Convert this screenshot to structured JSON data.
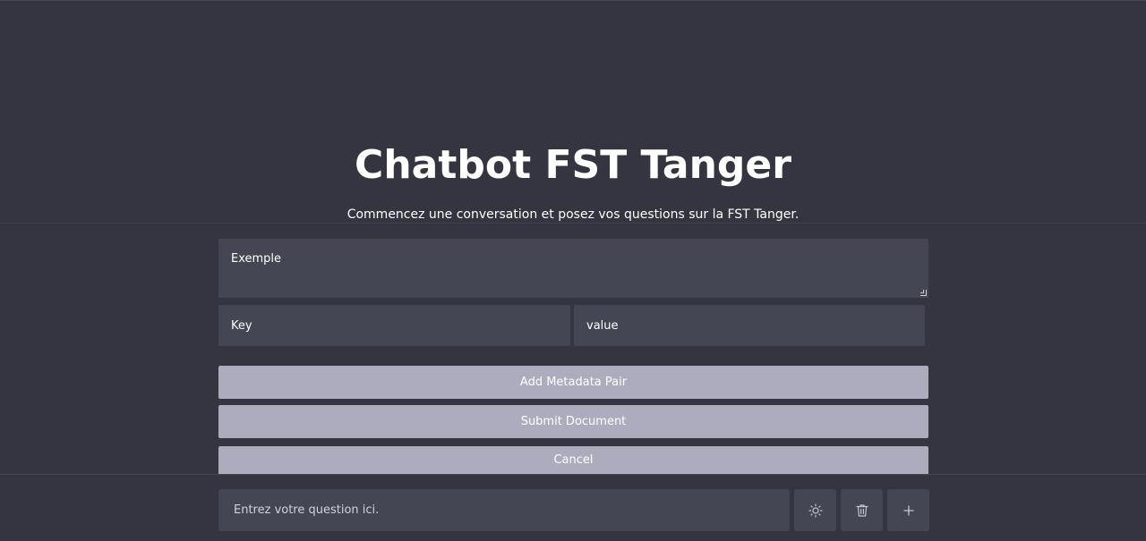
{
  "header": {
    "title": "Chatbot FST Tanger",
    "subtitle": "Commencez une conversation et posez vos questions sur la FST Tanger."
  },
  "document_form": {
    "content_placeholder": "Exemple",
    "metadata_key_placeholder": "Key",
    "metadata_value_placeholder": "value",
    "add_metadata_label": "Add Metadata Pair",
    "submit_label": "Submit Document",
    "cancel_label": "Cancel"
  },
  "chat_input": {
    "placeholder": "Entrez votre question ici."
  },
  "toolbar": {
    "icons": [
      "sun-icon",
      "trash-icon",
      "plus-icon"
    ]
  },
  "colors": {
    "background": "#343541",
    "input_background": "#444654",
    "button_background": "#acacbe",
    "text": "#ffffff"
  }
}
